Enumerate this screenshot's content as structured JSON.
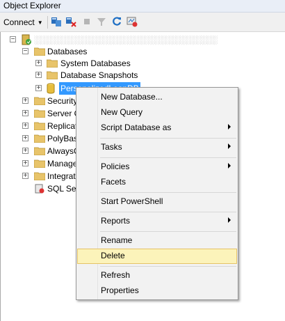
{
  "panel": {
    "title": "Object Explorer"
  },
  "toolbar": {
    "connect_label": "Connect",
    "icons": [
      "connect-object-explorer-icon",
      "disconnect-icon",
      "stop-icon",
      "filter-icon",
      "refresh-icon",
      "activity-monitor-icon"
    ]
  },
  "tree": {
    "server_label": "░░░░░░░░░░░░░░░░░░░░░░░░░░░░░░░░░░░",
    "databases": "Databases",
    "system_databases": "System Databases",
    "database_snapshots": "Database Snapshots",
    "selected_db": "PersonalizedLoanDB",
    "security": "Security",
    "server_objects": "Server O",
    "replication": "Replicat",
    "polybase": "PolyBas",
    "alwayson": "AlwaysO",
    "management": "Manage",
    "integration": "Integrat",
    "sql_agent": "SQL Ser"
  },
  "context_menu": {
    "items": [
      {
        "label": "New Database...",
        "submenu": false
      },
      {
        "label": "New Query",
        "submenu": false
      },
      {
        "label": "Script Database as",
        "submenu": true
      },
      {
        "label": "Tasks",
        "submenu": true
      },
      {
        "label": "Policies",
        "submenu": true
      },
      {
        "label": "Facets",
        "submenu": false
      },
      {
        "label": "Start PowerShell",
        "submenu": false
      },
      {
        "label": "Reports",
        "submenu": true
      },
      {
        "label": "Rename",
        "submenu": false
      },
      {
        "label": "Delete",
        "submenu": false,
        "highlighted": true
      },
      {
        "label": "Refresh",
        "submenu": false
      },
      {
        "label": "Properties",
        "submenu": false
      }
    ]
  },
  "colors": {
    "selection": "#3399ff",
    "menu_hover": "#fcf3ba",
    "folder": "#e8c46a"
  }
}
